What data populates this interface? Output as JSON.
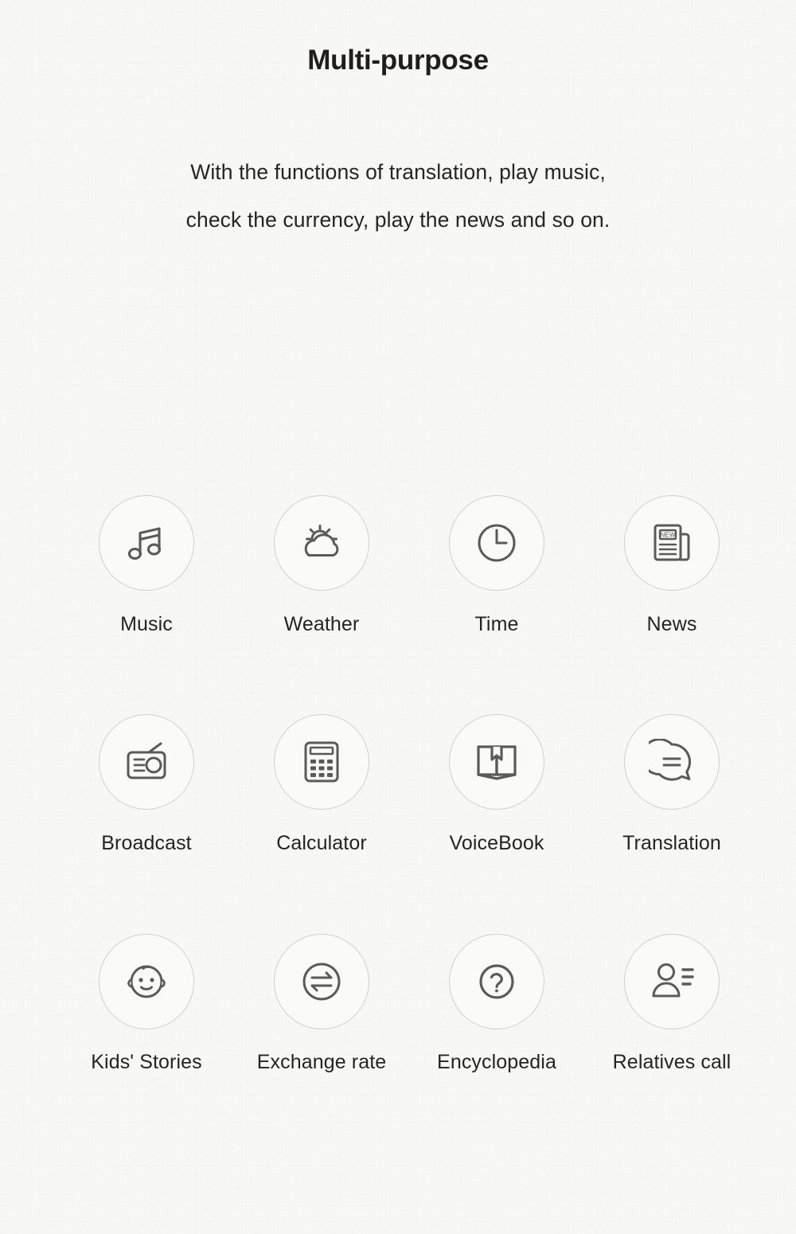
{
  "header": {
    "title": "Multi-purpose",
    "subtitle_line1": "With the functions of translation, play music,",
    "subtitle_line2": "check the currency, play the news and so on."
  },
  "colors": {
    "background": "#f7f7f6",
    "text": "#231f20",
    "circle_border": "#cfcfcf",
    "icon_stroke": "#5a5a5a"
  },
  "features": {
    "rows": [
      [
        {
          "label": "Music",
          "icon": "music-note-icon"
        },
        {
          "label": "Weather",
          "icon": "sun-behind-cloud-icon"
        },
        {
          "label": "Time",
          "icon": "clock-icon"
        },
        {
          "label": "News",
          "icon": "newspaper-icon",
          "icon_text": "NEW"
        }
      ],
      [
        {
          "label": "Broadcast",
          "icon": "radio-icon"
        },
        {
          "label": "Calculator",
          "icon": "calculator-icon"
        },
        {
          "label": "VoiceBook",
          "icon": "open-book-icon"
        },
        {
          "label": "Translation",
          "icon": "speech-bubble-equals-icon"
        }
      ],
      [
        {
          "label": "Kids' Stories",
          "icon": "baby-face-icon"
        },
        {
          "label": "Exchange rate",
          "icon": "exchange-arrows-icon"
        },
        {
          "label": "Encyclopedia",
          "icon": "question-mark-circle-icon"
        },
        {
          "label": "Relatives call",
          "icon": "person-contact-icon"
        }
      ]
    ]
  }
}
